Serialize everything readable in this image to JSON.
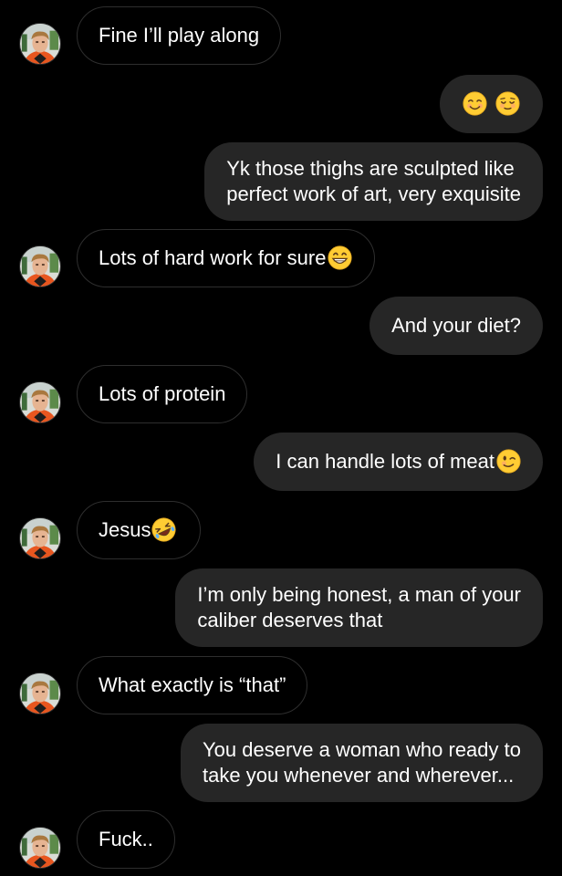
{
  "contact": {
    "avatar_icon": "contact-avatar-icon"
  },
  "messages": [
    {
      "from": "them",
      "text": "Fine I’ll play along"
    },
    {
      "from": "me",
      "emoji_icons": [
        "smiling-face-icon",
        "relieved-face-icon"
      ]
    },
    {
      "from": "me",
      "lines": [
        "Yk those thighs are sculpted like",
        "perfect work of art, very exquisite"
      ]
    },
    {
      "from": "them",
      "text": "Lots of hard work for sure",
      "emoji_icon": "grinning-face-icon"
    },
    {
      "from": "me",
      "text": "And your diet?"
    },
    {
      "from": "them",
      "text": "Lots of protein"
    },
    {
      "from": "me",
      "text": "I can handle lots of meat",
      "emoji_icon": "winking-face-icon"
    },
    {
      "from": "them",
      "text": "Jesus",
      "emoji_icon": "rolling-laughing-face-icon"
    },
    {
      "from": "me",
      "lines": [
        "I’m only being honest, a man of your",
        "caliber deserves that"
      ]
    },
    {
      "from": "them",
      "text": "What exactly is “that”"
    },
    {
      "from": "me",
      "lines": [
        "You deserve a woman who ready to",
        "take you whenever and wherever..."
      ]
    },
    {
      "from": "them",
      "text": "Fuck.."
    }
  ],
  "colors": {
    "background": "#000000",
    "sent_bubble": "#262626",
    "received_bubble_border": "#2e2e2e",
    "text": "#ffffff"
  }
}
